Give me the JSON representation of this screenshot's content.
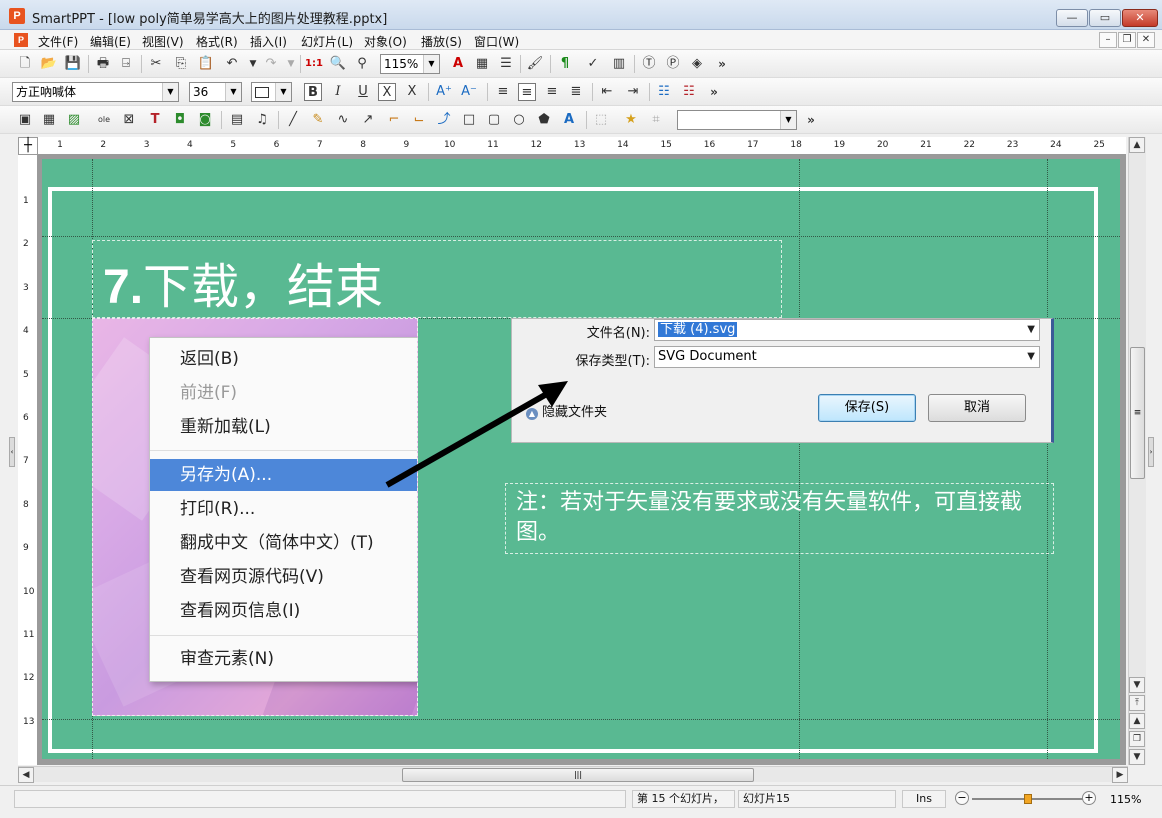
{
  "window": {
    "title": "SmartPPT - [low poly简单易学高大上的图片处理教程.pptx]",
    "app_icon": "P"
  },
  "menu": [
    "文件(F)",
    "编辑(E)",
    "视图(V)",
    "格式(R)",
    "插入(I)",
    "幻灯片(L)",
    "对象(O)",
    "播放(S)",
    "窗口(W)"
  ],
  "toolbar1": {
    "zoom": "115%",
    "more": "»"
  },
  "toolbar2": {
    "font_name": "方正吶喊体",
    "font_size": "36",
    "more": "»"
  },
  "toolbar3": {
    "more": "»"
  },
  "ruler": {
    "h_ticks": [
      "1",
      "2",
      "3",
      "4",
      "5",
      "6",
      "7",
      "8",
      "9",
      "10",
      "11",
      "12",
      "13",
      "14",
      "15",
      "16",
      "17",
      "18",
      "19",
      "20",
      "21",
      "22",
      "23",
      "24",
      "25"
    ],
    "v_ticks": [
      "1",
      "2",
      "3",
      "4",
      "5",
      "6",
      "7",
      "8",
      "9",
      "10",
      "11",
      "12",
      "13"
    ]
  },
  "slide": {
    "title_num": "7.",
    "title_text": "下载，结束",
    "context_menu": {
      "items": [
        {
          "label": "返回(B)",
          "state": "normal"
        },
        {
          "label": "前进(F)",
          "state": "disabled"
        },
        {
          "label": "重新加载(L)",
          "state": "normal"
        },
        {
          "label": "另存为(A)...",
          "state": "selected"
        },
        {
          "label": "打印(R)...",
          "state": "normal"
        },
        {
          "label": "翻成中文（简体中文）(T)",
          "state": "normal"
        },
        {
          "label": "查看网页源代码(V)",
          "state": "normal"
        },
        {
          "label": "查看网页信息(I)",
          "state": "normal"
        },
        {
          "label": "审查元素(N)",
          "state": "normal"
        }
      ]
    },
    "save_dialog": {
      "filename_label": "文件名(N):",
      "filename_value": "下载 (4).svg",
      "type_label": "保存类型(T):",
      "type_value": "SVG Document",
      "hide_folders": "隐藏文件夹",
      "save_button": "保存(S)",
      "cancel_button": "取消"
    },
    "note": "注：若对于矢量没有要求或没有矢量软件，可直接截图。",
    "colors": {
      "background": "#59b992",
      "frame": "#ffffff",
      "selected": "#4d87d9"
    }
  },
  "status": {
    "slide_count": "第 15 个幻灯片，",
    "current_slide": "幻灯片15",
    "mode": "Ins",
    "zoom": "115%"
  }
}
